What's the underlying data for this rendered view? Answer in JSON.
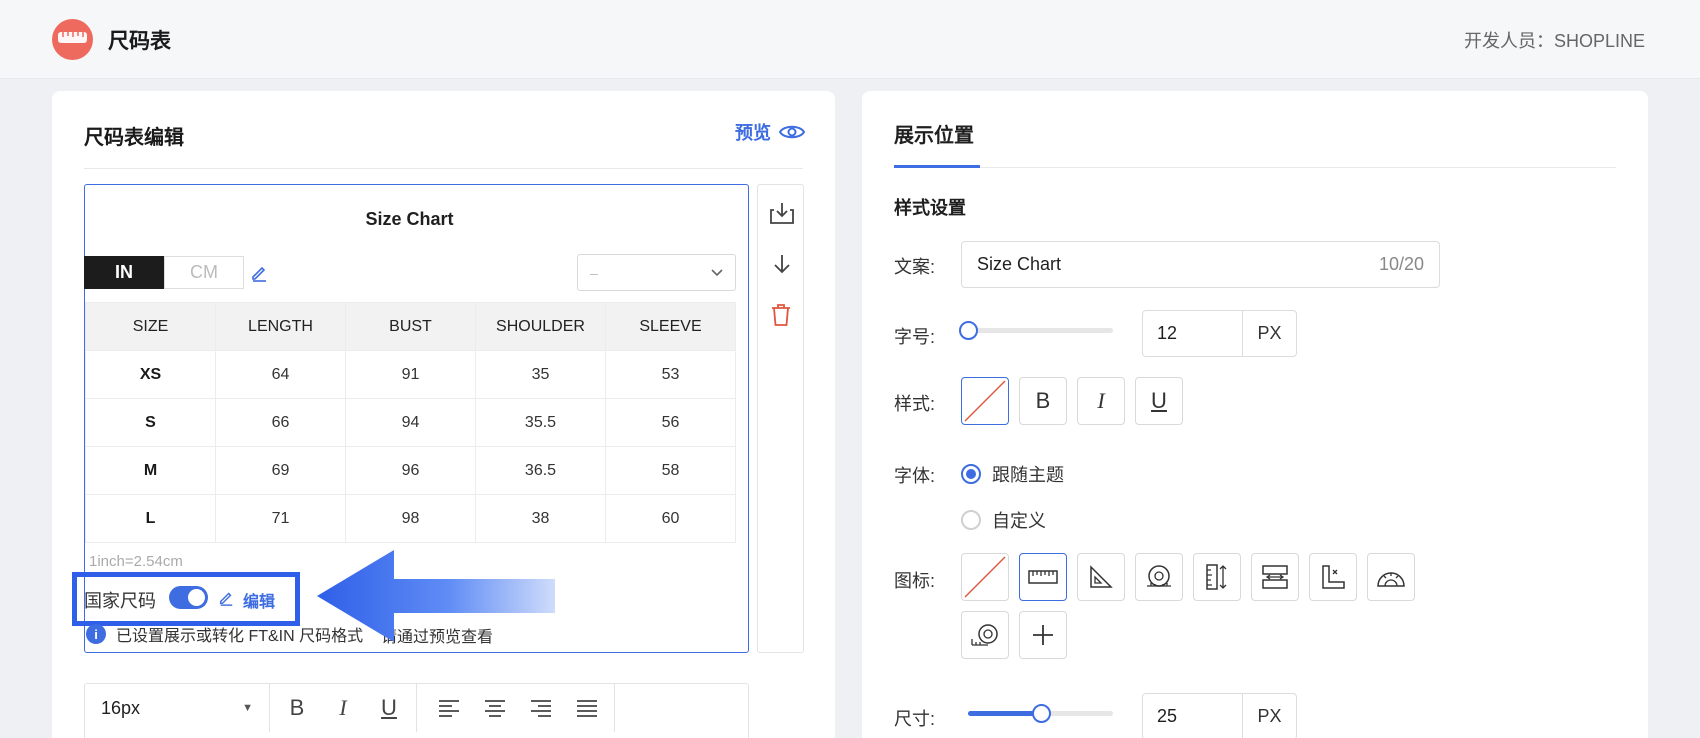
{
  "header": {
    "app_title": "尺码表",
    "developer": "开发人员：SHOPLINE"
  },
  "editor": {
    "title": "尺码表编辑",
    "preview_label": "预览",
    "chart_title": "Size Chart",
    "unit_in": "IN",
    "unit_cm": "CM",
    "unit_select_value": "–",
    "table": {
      "headers": [
        "SIZE",
        "LENGTH",
        "BUST",
        "SHOULDER",
        "SLEEVE"
      ],
      "rows": [
        [
          "XS",
          "64",
          "91",
          "35",
          "53"
        ],
        [
          "S",
          "66",
          "94",
          "35.5",
          "56"
        ],
        [
          "M",
          "69",
          "96",
          "36.5",
          "58"
        ],
        [
          "L",
          "71",
          "98",
          "38",
          "60"
        ]
      ]
    },
    "conversion_note": "1inch=2.54cm",
    "country_size_label": "国家尺码",
    "country_size_enabled": true,
    "country_edit_label": "编辑",
    "info_text_1": "已设置展示或转化 FT&IN 尺码格式",
    "info_text_2": "请通过预览查看"
  },
  "toolbar": {
    "font_size": "16px",
    "bold": "B",
    "italic": "I",
    "underline": "U"
  },
  "display": {
    "tab_title": "展示位置",
    "section_title": "样式设置",
    "copy_label": "文案:",
    "copy_value": "Size Chart",
    "copy_count": "10/20",
    "font_size_label": "字号:",
    "font_size_value": "12",
    "font_size_unit": "PX",
    "font_size_slider": 0.0,
    "style_label": "样式:",
    "style_bold": "B",
    "style_italic": "I",
    "style_underline": "U",
    "font_label": "字体:",
    "font_option_theme": "跟随主题",
    "font_option_custom": "自定义",
    "icon_label": "图标:",
    "size_label": "尺寸:",
    "size_value": "25",
    "size_unit": "PX",
    "size_slider": 0.5
  },
  "colors": {
    "accent": "#3d6de0",
    "logo": "#ef6a5e",
    "delete": "#e0553f"
  }
}
